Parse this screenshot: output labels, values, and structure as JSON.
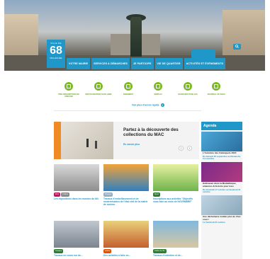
{
  "hero": {
    "logo": {
      "line1": "VILLE DE",
      "number": "68",
      "line2": "MULHOUSE"
    }
  },
  "topnav": [
    "VOTRE MAIRIE",
    "SERVICES & DÉMARCHES",
    "JE PARTICIPE",
    "VIE DE QUARTIER",
    "ACTIVITÉS ET ÉVÉNEMENTS"
  ],
  "quick_access": {
    "items": [
      {
        "label": "PRÉ-INSCRIPTION EN CRÈCHE",
        "icon": "crib-icon"
      },
      {
        "label": "RESTAURATION SCOLAIRE",
        "icon": "meal-icon"
      },
      {
        "label": "PAIEMENT",
        "icon": "percent-icon"
      },
      {
        "label": "EMPLOI",
        "icon": "briefcase-icon"
      },
      {
        "label": "MARCHÉS PUBLICS",
        "icon": "document-icon"
      },
      {
        "label": "JOURNAL DU MAG",
        "icon": "newspaper-icon"
      }
    ],
    "more_label": "Voir plus d'accès rapide",
    "more_icon": "+"
  },
  "promo": {
    "title": "Partez à la découverte des collections du MAC",
    "link": "En savoir plus",
    "prev": "‹",
    "next": "›"
  },
  "agenda": {
    "heading": "Agenda",
    "items": [
      {
        "title": "L'Automne des Calanquets 2024",
        "date": "Du Samedi 26 septembre au Dimanche 3 novembre"
      },
      {
        "title": "Halloween dans la Médiathèque, antennes & histoire pour tous",
        "date": "Du Vendredi 17 octobre au Vendredi 31 octobre"
      },
      {
        "title": "Une déchetterie mobile près de chez vous !",
        "date": "Le Vendredi 24 octobre"
      }
    ]
  },
  "cards": [
    {
      "tags": [
        "Prox",
        "Culture"
      ],
      "title": "Les expositions dans les musées du M4"
    },
    {
      "tags": [
        "Travaux"
      ],
      "title": "Travaux d'embellissement et de modernisation de l'état civil de la mairie de secteur"
    },
    {
      "tags": [
        "Sport"
      ],
      "title": "Inscriptions aux activités \"Objectifs vous bien au mois de NOVEMBRE\""
    },
    {
      "tags": [
        "Travaux"
      ],
      "title": "Travaux en cours rue de..."
    },
    {
      "tags": [
        "Loisirs"
      ],
      "title": "Des activités à faire en..."
    },
    {
      "tags": [
        "Cadre de Vie"
      ],
      "title": "Travaux d'entretien et de..."
    }
  ],
  "colors": {
    "brand_blue": "#1f97c9",
    "green": "#7cb928",
    "orange": "#f08a24"
  }
}
